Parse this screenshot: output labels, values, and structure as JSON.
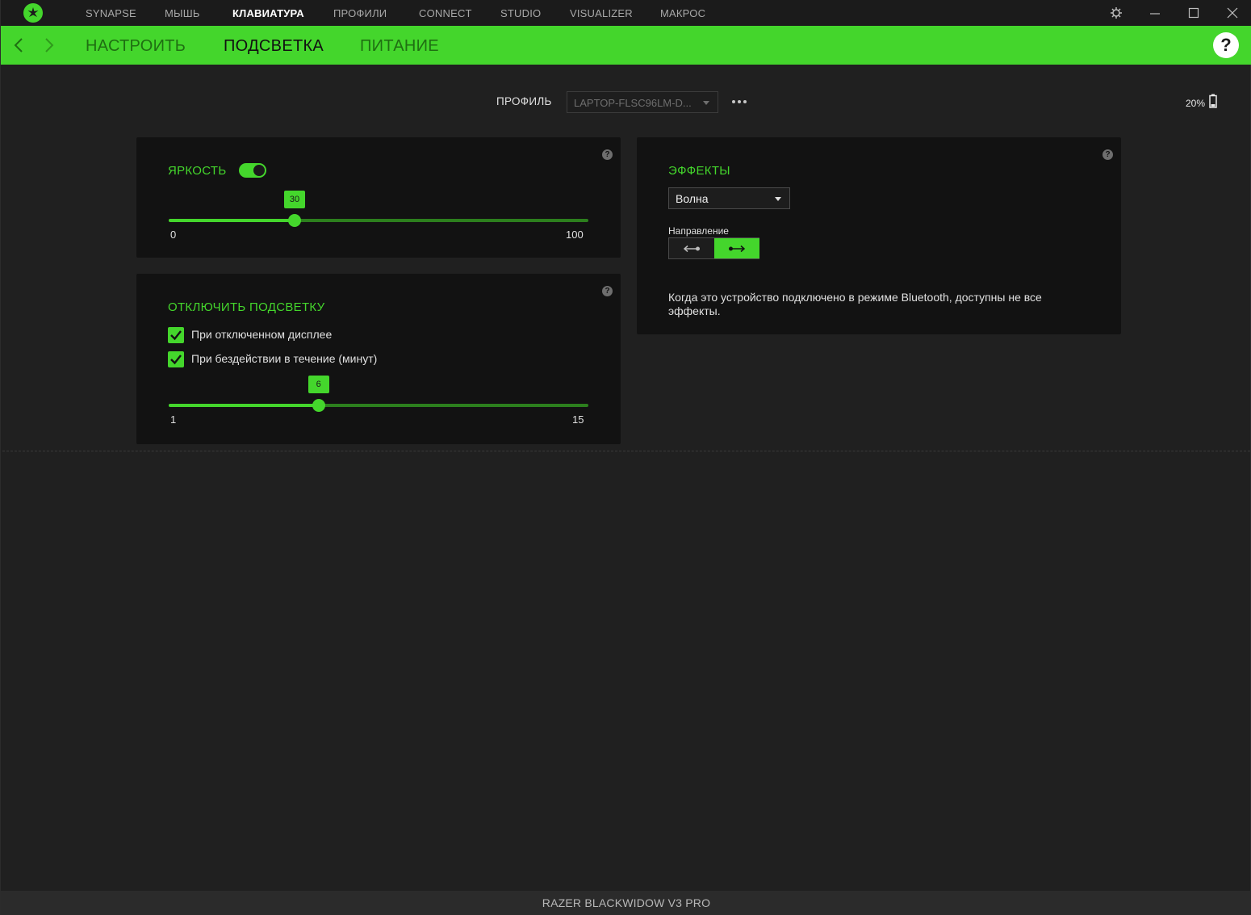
{
  "app": {
    "nav": [
      {
        "label": "SYNAPSE"
      },
      {
        "label": "МЫШЬ"
      },
      {
        "label": "КЛАВИАТУРА",
        "active": true
      },
      {
        "label": "ПРОФИЛИ"
      },
      {
        "label": "CONNECT"
      },
      {
        "label": "STUDIO"
      },
      {
        "label": "VISUALIZER"
      },
      {
        "label": "МАКРОС"
      }
    ],
    "window_icons": [
      "settings-icon",
      "minimize-icon",
      "maximize-icon",
      "close-icon"
    ]
  },
  "subnav": {
    "tabs": [
      {
        "label": "НАСТРОИТЬ"
      },
      {
        "label": "ПОДСВЕТКА",
        "active": true
      },
      {
        "label": "ПИТАНИЕ"
      }
    ],
    "help": "?"
  },
  "profile": {
    "label": "ПРОФИЛЬ",
    "value": "LAPTOP-FLSC96LM-D...",
    "battery": "20%"
  },
  "brightness": {
    "title": "ЯРКОСТЬ",
    "enabled": true,
    "value": "30",
    "min": "0",
    "max": "100",
    "fraction": 0.3
  },
  "lights_off": {
    "title": "ОТКЛЮЧИТЬ ПОДСВЕТКУ",
    "options": [
      {
        "label": "При отключенном дисплее",
        "checked": true
      },
      {
        "label": "При бездействии в течение (минут)",
        "checked": true
      }
    ],
    "value": "6",
    "min": "1",
    "max": "15",
    "fraction": 0.357
  },
  "effects": {
    "title": "ЭФФЕКТЫ",
    "selected": "Волна",
    "direction_label": "Направление",
    "direction_selected": "right",
    "note": "Когда это устройство подключено в режиме Bluetooth, доступны не все эффекты."
  },
  "device": {
    "name": "RAZER BLACKWIDOW V3 PRO"
  },
  "colors": {
    "accent": "#44d62c",
    "background": "#202020",
    "panel": "#121212"
  }
}
